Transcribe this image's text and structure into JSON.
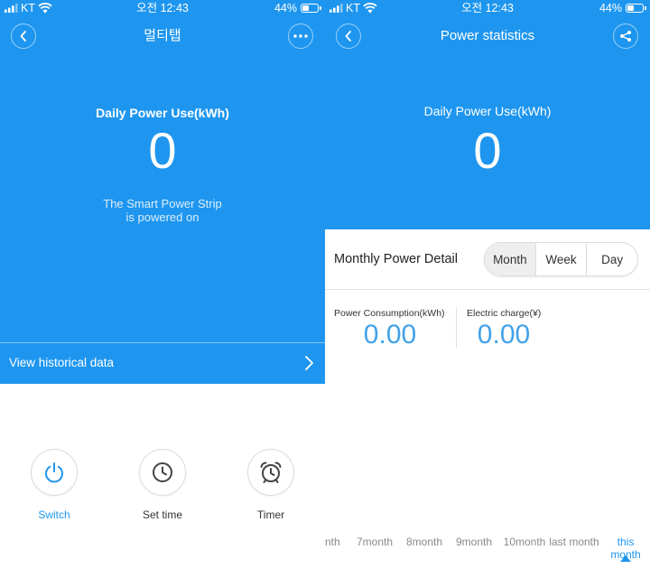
{
  "colors": {
    "primary": "#1E96EF",
    "value_blue": "#43A2E8",
    "segment_selected": "#EEEEEE"
  },
  "status_bar": {
    "carrier": "KT",
    "time": "오전 12:43",
    "battery": "44%",
    "icons": [
      "signal-icon",
      "wifi-icon",
      "battery-icon"
    ]
  },
  "device_screen": {
    "nav": {
      "title": "멀티탭",
      "left_icon": "chevron-left-icon",
      "right_icon": "more-horizontal-icon"
    },
    "summary": {
      "label": "Daily Power Use(kWh)",
      "value": "0",
      "status_lines": [
        "The Smart Power Strip",
        "is powered on"
      ]
    },
    "history_link": {
      "label": "View historical data",
      "icon": "chevron-right-icon"
    },
    "actions": [
      {
        "label": "Switch",
        "icon": "power-icon"
      },
      {
        "label": "Set time",
        "icon": "clock-icon"
      },
      {
        "label": "Timer",
        "icon": "alarm-clock-icon"
      }
    ]
  },
  "statistics_screen": {
    "nav": {
      "title": "Power statistics",
      "left_icon": "chevron-left-icon",
      "right_icon": "share-icon"
    },
    "summary": {
      "label": "Daily Power Use(kWh)",
      "value": "0"
    },
    "detail": {
      "title": "Monthly Power Detail",
      "segments": [
        "Month",
        "Week",
        "Day"
      ],
      "selected_segment": "Month",
      "stats": [
        {
          "label": "Power Consumption(kWh)",
          "value": "0.00"
        },
        {
          "label": "Electric charge(¥)",
          "value": "0.00"
        }
      ]
    },
    "timeline": {
      "labels": [
        "nth",
        "7month",
        "8month",
        "9month",
        "10month",
        "last month"
      ],
      "current": "this month",
      "current_indicator_icon": "triangle-up-icon"
    }
  }
}
